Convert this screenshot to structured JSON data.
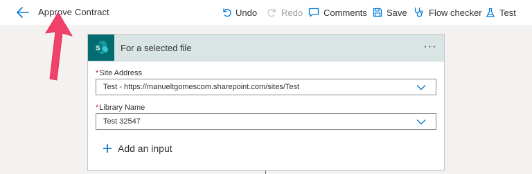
{
  "header": {
    "flow_title": "Approve Contract",
    "toolbar": {
      "undo_label": "Undo",
      "redo_label": "Redo",
      "comments_label": "Comments",
      "save_label": "Save",
      "flow_checker_label": "Flow checker",
      "test_label": "Test"
    }
  },
  "trigger_card": {
    "title": "For a selected file",
    "more_label": "···",
    "fields": [
      {
        "label": "Site Address",
        "required_marker": "*",
        "value": "Test - https://manueltgomescom.sharepoint.com/sites/Test"
      },
      {
        "label": "Library Name",
        "required_marker": "*",
        "value": "Test 32547"
      }
    ],
    "add_input_label": "Add an input"
  },
  "colors": {
    "accent": "#0078d4",
    "sharepoint_teal": "#036c70",
    "card_header": "#d9e4e4",
    "annotation_arrow": "#f0416b"
  }
}
